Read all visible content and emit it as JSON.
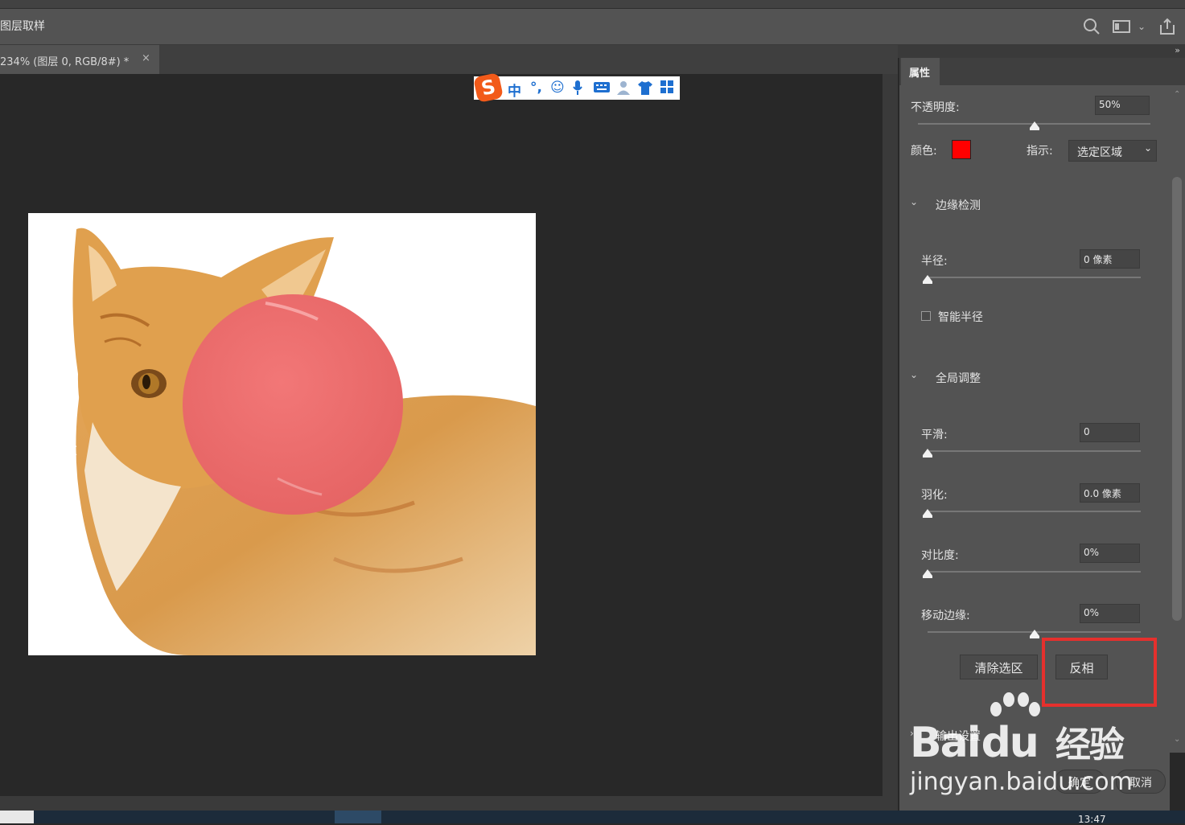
{
  "app": {
    "tool_name": "图层取样",
    "document_tab": "234% (图层 0, RGB/8#) *",
    "close_symbol": "×"
  },
  "ime_toolbar": {
    "logo": "S",
    "items": [
      "中",
      "°,",
      "☺",
      "🎤",
      "⌨",
      "👤",
      "👕",
      "▦"
    ]
  },
  "properties_panel": {
    "tab_label": "属性",
    "opacity_label": "不透明度:",
    "opacity_value": "50%",
    "opacity_level": 0.5,
    "color_label": "颜色:",
    "color_swatch": "#ff0000",
    "indicate_label": "指示:",
    "indicate_value": "选定区域",
    "edge_detection": {
      "section_title": "边缘检测",
      "radius_label": "半径:",
      "radius_value": "0 像素",
      "smart_radius_label": "智能半径",
      "smart_radius_checked": false
    },
    "global_refine": {
      "section_title": "全局调整",
      "smooth_label": "平滑:",
      "smooth_value": "0",
      "feather_label": "羽化:",
      "feather_value": "0.0 像素",
      "contrast_label": "对比度:",
      "contrast_value": "0%",
      "shift_edge_label": "移动边缘:",
      "shift_edge_value": "0%",
      "shift_edge_level": 0.5
    },
    "clear_selection_button": "清除选区",
    "invert_button": "反相",
    "output_section_title": "输出设置",
    "ok_button": "确定",
    "cancel_button": "取消"
  },
  "watermark": {
    "brand": "Bai",
    "brand2": "du",
    "cn": "经验",
    "url": "jingyan.baidu.com"
  },
  "taskbar": {
    "clock": "13:47"
  },
  "colors": {
    "highlight_box": "#e5302d",
    "overlay_circle": "#f07070"
  }
}
